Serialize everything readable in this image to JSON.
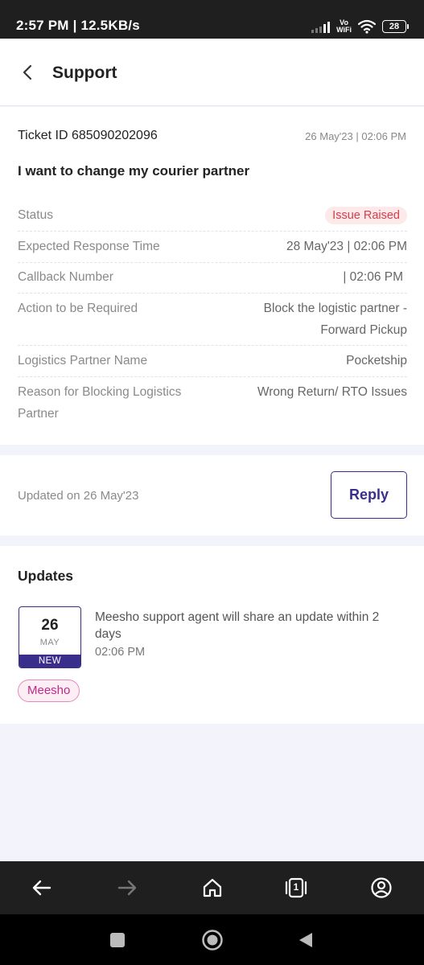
{
  "status_bar": {
    "time_speed": "2:57 PM | 12.5KB/s",
    "vowifi_top": "Vo",
    "vowifi_bottom": "WiFi",
    "battery": "28"
  },
  "header": {
    "title": "Support"
  },
  "ticket": {
    "id_label": "Ticket ID 685090202096",
    "date": "26 May'23 | 02:06 PM",
    "subject": "I want to change my courier partner",
    "details": [
      {
        "label": "Status",
        "value": "Issue Raised"
      },
      {
        "label": "Expected Response Time",
        "value": "28 May'23 | 02:06 PM"
      },
      {
        "label": "Callback Number",
        "value": "| 02:06 PM"
      },
      {
        "label": "Action to be Required",
        "value": "Block the logistic partner - Forward Pickup"
      },
      {
        "label": "Logistics Partner Name",
        "value": "Pocketship"
      },
      {
        "label": "Reason for Blocking Logistics Partner",
        "value": "Wrong Return/ RTO Issues"
      }
    ]
  },
  "reply_section": {
    "updated_text": "Updated on 26 May'23",
    "reply_label": "Reply"
  },
  "updates": {
    "title": "Updates",
    "items": [
      {
        "day": "26",
        "month": "MAY",
        "badge": "NEW",
        "message": "Meesho support agent will share an update within 2 days",
        "time": "02:06 PM",
        "source": "Meesho"
      }
    ]
  },
  "browser_nav": {
    "tabs_count": "1"
  },
  "colors": {
    "accent": "#3a2e8c",
    "status_red": "#d1404b",
    "status_bg": "#fde8ea",
    "meesho_pink": "#c2288a",
    "page_bg": "#f2f3fb"
  },
  "icons": [
    "back-arrow-icon",
    "signal-icon",
    "wifi-icon",
    "battery-icon",
    "browser-back-icon",
    "browser-forward-icon",
    "home-icon",
    "tabs-icon",
    "account-icon",
    "recents-square-icon",
    "home-circle-icon",
    "back-triangle-icon"
  ]
}
